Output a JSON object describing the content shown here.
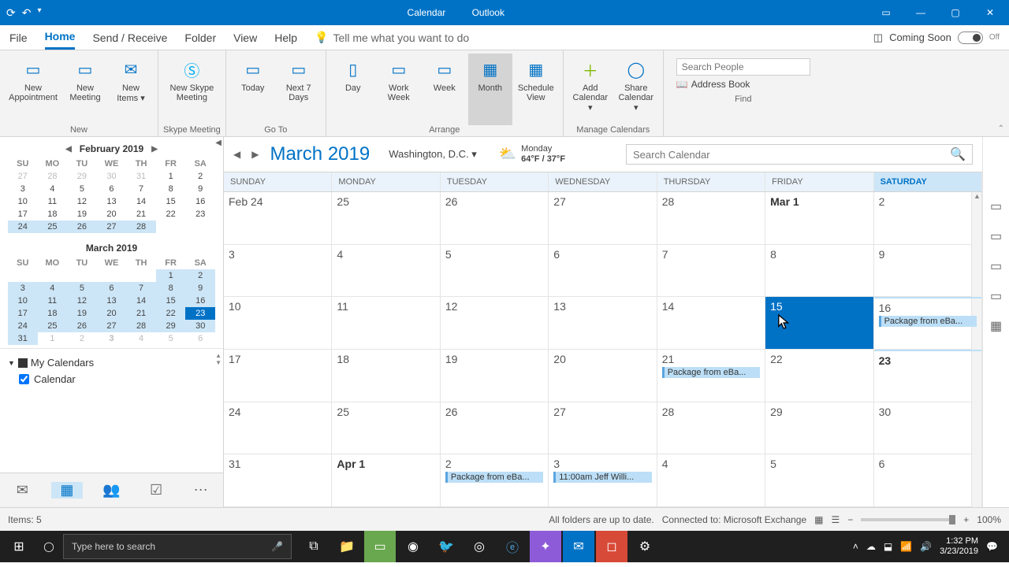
{
  "titlebar": {
    "left1": "Calendar",
    "left2": "Outlook"
  },
  "menubar": {
    "file": "File",
    "home": "Home",
    "sendrecv": "Send / Receive",
    "folder": "Folder",
    "view": "View",
    "help": "Help",
    "tellme": "Tell me what you want to do",
    "coming": "Coming Soon",
    "off": "Off"
  },
  "ribbon": {
    "new_appt_l1": "New",
    "new_appt_l2": "Appointment",
    "new_meeting_l1": "New",
    "new_meeting_l2": "Meeting",
    "new_items_l1": "New",
    "new_items_l2": "Items ▾",
    "skype_l1": "New Skype",
    "skype_l2": "Meeting",
    "today": "Today",
    "next7_l1": "Next 7",
    "next7_l2": "Days",
    "day": "Day",
    "workweek_l1": "Work",
    "workweek_l2": "Week",
    "week": "Week",
    "month": "Month",
    "schedule_l1": "Schedule",
    "schedule_l2": "View",
    "addcal_l1": "Add",
    "addcal_l2": "Calendar ▾",
    "sharecal_l1": "Share",
    "sharecal_l2": "Calendar ▾",
    "search_ph": "Search People",
    "addressbook": "Address Book",
    "grp_new": "New",
    "grp_skype": "Skype Meeting",
    "grp_goto": "Go To",
    "grp_arrange": "Arrange",
    "grp_manage": "Manage Calendars",
    "grp_find": "Find"
  },
  "mini_feb": {
    "title": "February 2019",
    "dh": [
      "SU",
      "MO",
      "TU",
      "WE",
      "TH",
      "FR",
      "SA"
    ],
    "rows": [
      [
        "27",
        "28",
        "29",
        "30",
        "31",
        "1",
        "2"
      ],
      [
        "3",
        "4",
        "5",
        "6",
        "7",
        "8",
        "9"
      ],
      [
        "10",
        "11",
        "12",
        "13",
        "14",
        "15",
        "16"
      ],
      [
        "17",
        "18",
        "19",
        "20",
        "21",
        "22",
        "23"
      ],
      [
        "24",
        "25",
        "26",
        "27",
        "28",
        "",
        ""
      ]
    ]
  },
  "mini_mar": {
    "title": "March 2019",
    "dh": [
      "SU",
      "MO",
      "TU",
      "WE",
      "TH",
      "FR",
      "SA"
    ],
    "rows": [
      [
        "",
        "",
        "",
        "",
        "",
        "1",
        "2"
      ],
      [
        "3",
        "4",
        "5",
        "6",
        "7",
        "8",
        "9"
      ],
      [
        "10",
        "11",
        "12",
        "13",
        "14",
        "15",
        "16"
      ],
      [
        "17",
        "18",
        "19",
        "20",
        "21",
        "22",
        "23"
      ],
      [
        "24",
        "25",
        "26",
        "27",
        "28",
        "29",
        "30"
      ],
      [
        "31",
        "1",
        "2",
        "3",
        "4",
        "5",
        "6"
      ]
    ]
  },
  "mycals": {
    "title": "My Calendars",
    "item1": "Calendar"
  },
  "calview": {
    "title": "March 2019",
    "location": "Washington,  D.C. ▾",
    "weather_day": "Monday",
    "weather_temp": "64°F / 37°F",
    "search_ph": "Search Calendar",
    "heads": [
      "SUNDAY",
      "MONDAY",
      "TUESDAY",
      "WEDNESDAY",
      "THURSDAY",
      "FRIDAY",
      "SATURDAY"
    ],
    "cells": [
      [
        "Feb 24",
        "25",
        "26",
        "27",
        "28",
        "Mar 1",
        "2"
      ],
      [
        "3",
        "4",
        "5",
        "6",
        "7",
        "8",
        "9"
      ],
      [
        "10",
        "11",
        "12",
        "13",
        "14",
        "15",
        "16"
      ],
      [
        "17",
        "18",
        "19",
        "20",
        "21",
        "22",
        "23"
      ],
      [
        "24",
        "25",
        "26",
        "27",
        "28",
        "29",
        "30"
      ],
      [
        "31",
        "Apr 1",
        "2",
        "3",
        "4",
        "5",
        "6"
      ]
    ],
    "ev_sat16": "Package from eBa...",
    "ev_thu21": "Package from eBa...",
    "ev_tue2": "Package from eBa...",
    "ev_wed3": "11:00am Jeff Willi..."
  },
  "status": {
    "items": "Items: 5",
    "folders": "All folders are up to date.",
    "connected": "Connected to: Microsoft Exchange",
    "zoom": "100%"
  },
  "taskbar": {
    "search_ph": "Type here to search",
    "time": "1:32 PM",
    "date": "3/23/2019"
  }
}
